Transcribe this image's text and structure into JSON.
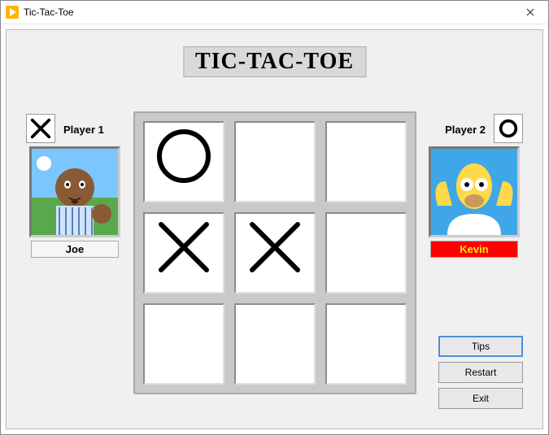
{
  "window": {
    "title": "Tic-Tac-Toe"
  },
  "heading": "TIC-TAC-TOE",
  "players": {
    "p1": {
      "label": "Player 1",
      "name": "Joe",
      "symbol": "X",
      "is_turn": false
    },
    "p2": {
      "label": "Player 2",
      "name": "Kevin",
      "symbol": "O",
      "is_turn": true
    }
  },
  "board": {
    "cells": [
      "O",
      "",
      "",
      "X",
      "X",
      "",
      "",
      "",
      ""
    ]
  },
  "buttons": {
    "tips": "Tips",
    "restart": "Restart",
    "exit": "Exit"
  },
  "icons": {
    "app": "play-icon",
    "close": "close-icon"
  }
}
